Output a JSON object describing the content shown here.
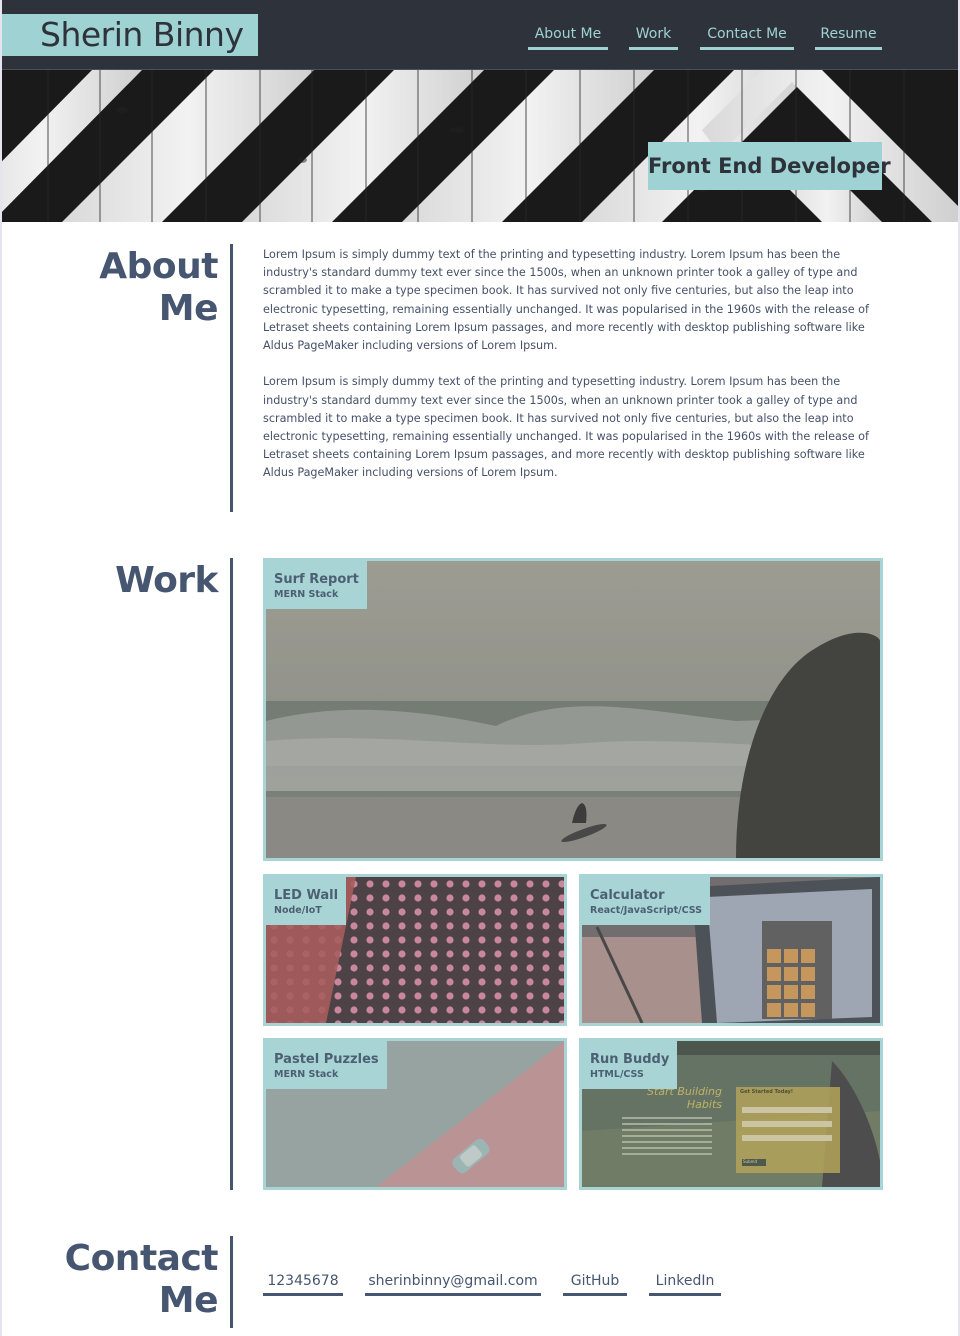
{
  "header": {
    "logo": "Sherin Binny",
    "nav": [
      {
        "label": "About Me"
      },
      {
        "label": "Work"
      },
      {
        "label": "Contact Me"
      },
      {
        "label": "Resume"
      }
    ]
  },
  "hero": {
    "tagline": "Front End Developer"
  },
  "about": {
    "title_line1": "About",
    "title_line2": "Me",
    "paragraphs": [
      "Lorem Ipsum is simply dummy text of the printing and typesetting industry. Lorem Ipsum has been the industry's standard dummy text ever since the 1500s, when an unknown printer took a galley of type and scrambled it to make a type specimen book. It has survived not only five centuries, but also the leap into electronic typesetting, remaining essentially unchanged. It was popularised in the 1960s with the release of Letraset sheets containing Lorem Ipsum passages, and more recently with desktop publishing software like Aldus PageMaker including versions of Lorem Ipsum.",
      "Lorem Ipsum is simply dummy text of the printing and typesetting industry. Lorem Ipsum has been the industry's standard dummy text ever since the 1500s, when an unknown printer took a galley of type and scrambled it to make a type specimen book. It has survived not only five centuries, but also the leap into electronic typesetting, remaining essentially unchanged. It was popularised in the 1960s with the release of Letraset sheets containing Lorem Ipsum passages, and more recently with desktop publishing software like Aldus PageMaker including versions of Lorem Ipsum."
    ]
  },
  "work": {
    "title": "Work",
    "projects": [
      {
        "name": "Surf Report",
        "stack": "MERN Stack"
      },
      {
        "name": "LED Wall",
        "stack": "Node/IoT"
      },
      {
        "name": "Calculator",
        "stack": "React/JavaScript/CSS"
      },
      {
        "name": "Pastel Puzzles",
        "stack": "MERN Stack"
      },
      {
        "name": "Run Buddy",
        "stack": "HTML/CSS"
      }
    ],
    "run_buddy_preview": {
      "headline_1": "Start Building",
      "headline_2": "Habits",
      "form_title": "Get Started Today!",
      "form_button": "Submit"
    }
  },
  "contact": {
    "title_line1": "Contact",
    "title_line2": "Me",
    "links": [
      {
        "label": "12345678"
      },
      {
        "label": "sherinbinny@gmail.com"
      },
      {
        "label": "GitHub"
      },
      {
        "label": "LinkedIn"
      }
    ]
  },
  "colors": {
    "header_bg": "#2e323b",
    "accent": "#9fd2d3",
    "heading": "#465570",
    "body_text": "#455068"
  }
}
